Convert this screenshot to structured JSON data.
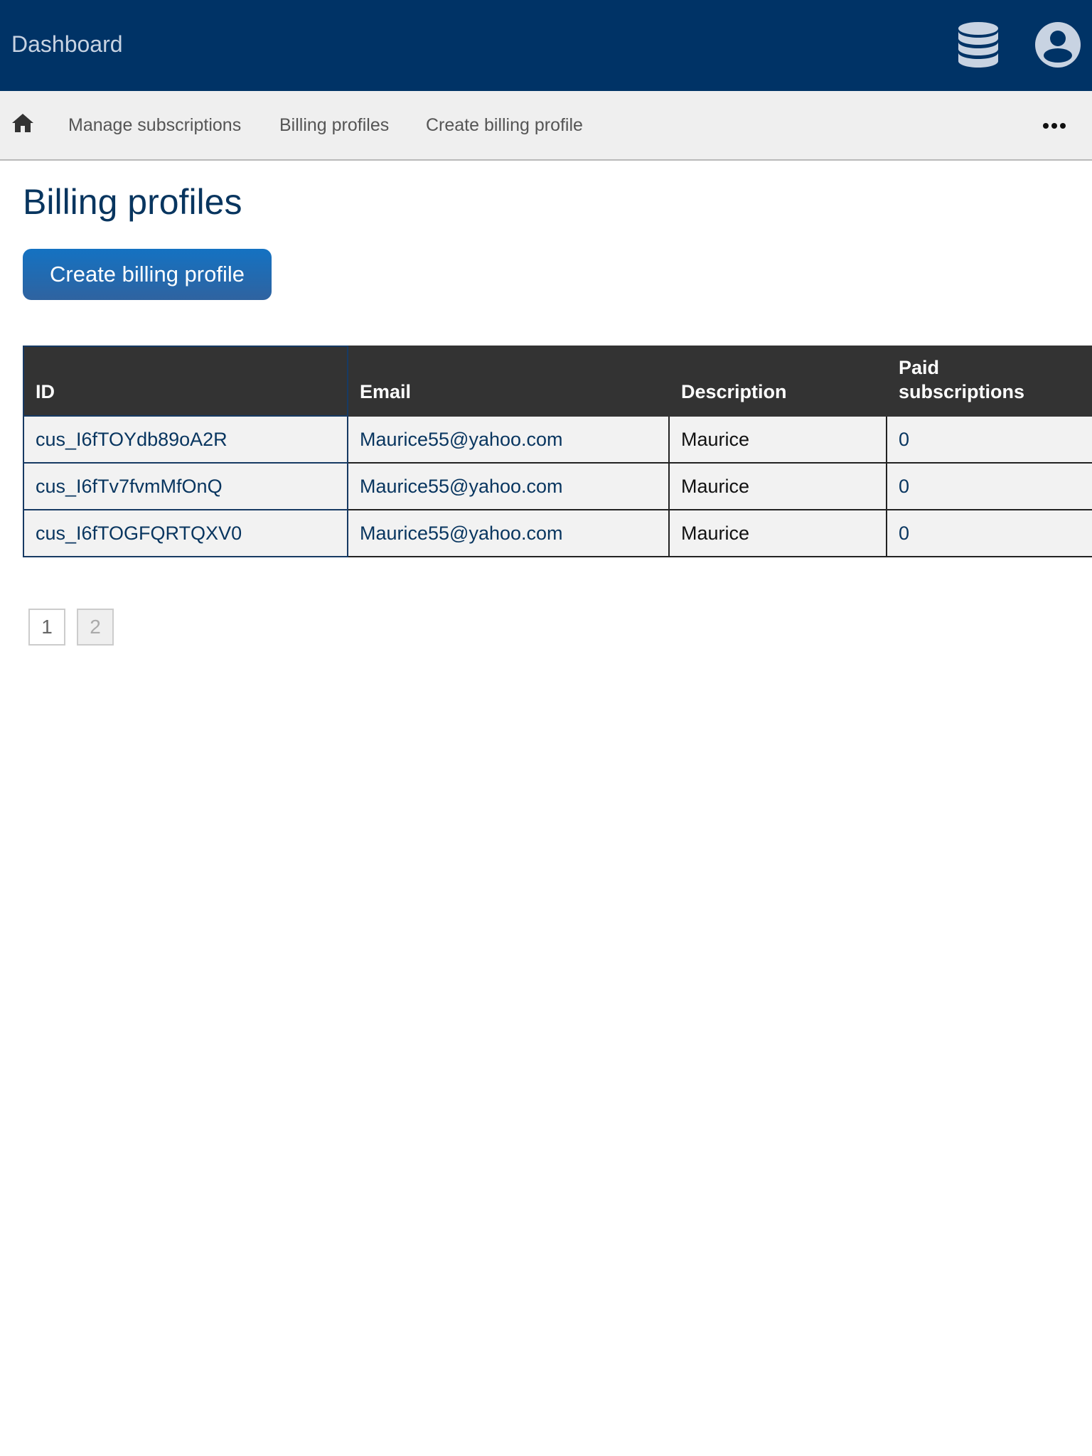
{
  "header": {
    "title": "Dashboard"
  },
  "nav": {
    "items": [
      {
        "label": "Manage subscriptions"
      },
      {
        "label": "Billing profiles"
      },
      {
        "label": "Create billing profile"
      }
    ]
  },
  "page": {
    "title": "Billing profiles",
    "create_button_label": "Create billing profile"
  },
  "table": {
    "columns": [
      "ID",
      "Email",
      "Description",
      "Paid\nsubscriptions"
    ],
    "rows": [
      {
        "id": "cus_I6fTOYdb89oA2R",
        "email": "Maurice55@yahoo.com",
        "description": "Maurice",
        "paid": "0"
      },
      {
        "id": "cus_I6fTv7fvmMfOnQ",
        "email": "Maurice55@yahoo.com",
        "description": "Maurice",
        "paid": "0"
      },
      {
        "id": "cus_I6fTOGFQRTQXV0",
        "email": "Maurice55@yahoo.com",
        "description": "Maurice",
        "paid": "0"
      }
    ]
  },
  "pagination": {
    "pages": [
      "1",
      "2"
    ]
  },
  "colors": {
    "header_bg": "#003366",
    "nav_bg": "#efefef",
    "accent": "#1472c2",
    "table_header_bg": "#333333",
    "link": "#08355f"
  },
  "icons": {
    "database": "database-icon",
    "user": "user-circle-icon",
    "home": "home-icon",
    "more": "more-horizontal-icon"
  }
}
